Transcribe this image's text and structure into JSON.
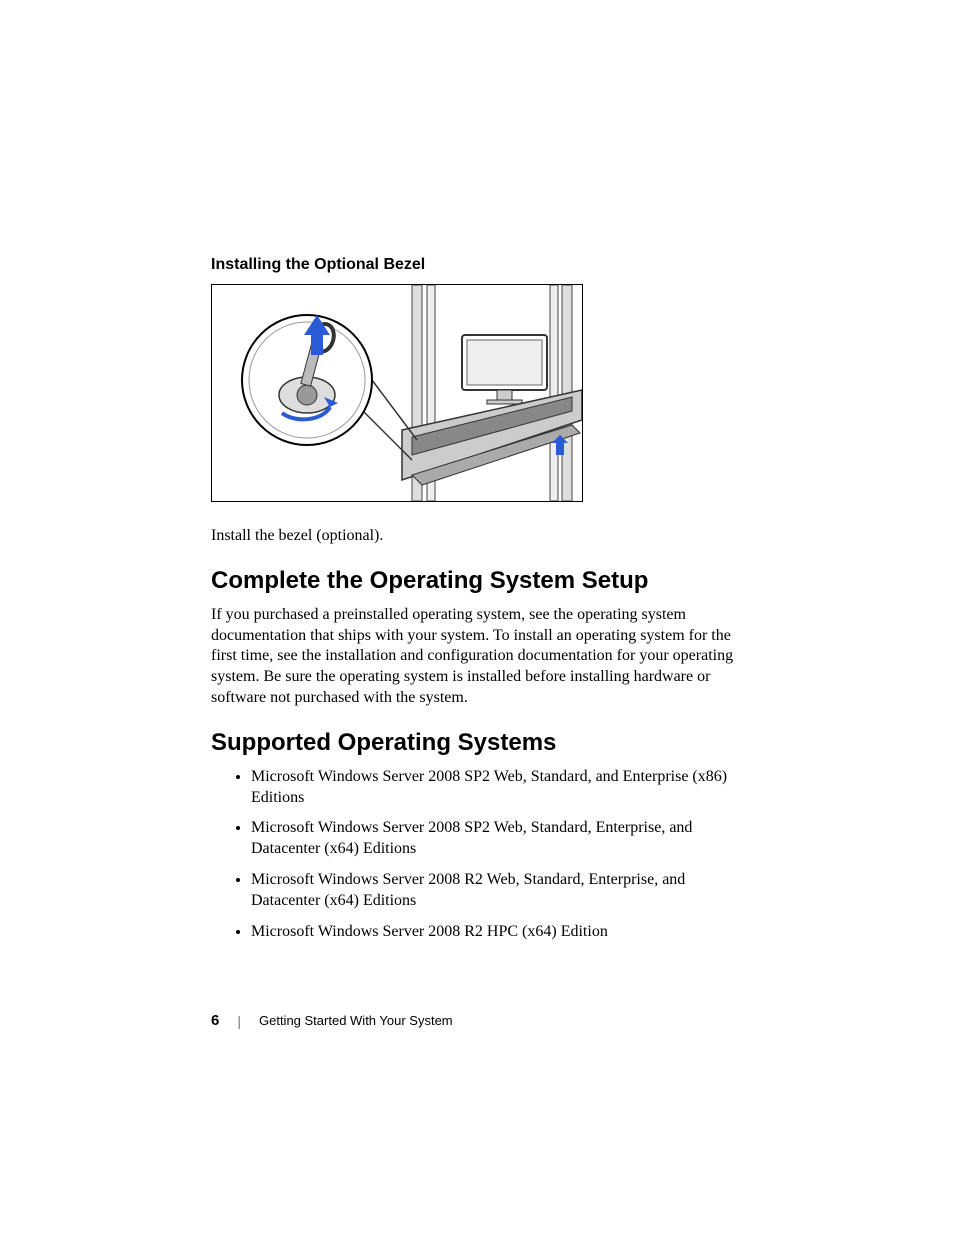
{
  "section": {
    "subheading": "Installing the Optional Bezel",
    "caption": "Install the bezel (optional).",
    "heading1": "Complete the Operating System Setup",
    "para1": "If you purchased a preinstalled operating system, see the operating system documentation that ships with your system. To install an operating system for the first time, see the installation and configuration documentation for your operating system. Be sure the operating system is installed before installing hardware or software not purchased with the system.",
    "heading2": "Supported Operating Systems",
    "os_list": [
      "Microsoft Windows Server 2008 SP2 Web, Standard, and Enterprise (x86) Editions",
      "Microsoft Windows Server 2008 SP2 Web, Standard, Enterprise, and Datacenter (x64) Editions",
      "Microsoft Windows Server 2008 R2 Web, Standard, Enterprise, and Datacenter (x64) Editions",
      "Microsoft Windows Server 2008 R2 HPC (x64) Edition"
    ]
  },
  "footer": {
    "page_number": "6",
    "separator": "|",
    "section_title": "Getting Started With Your System"
  }
}
